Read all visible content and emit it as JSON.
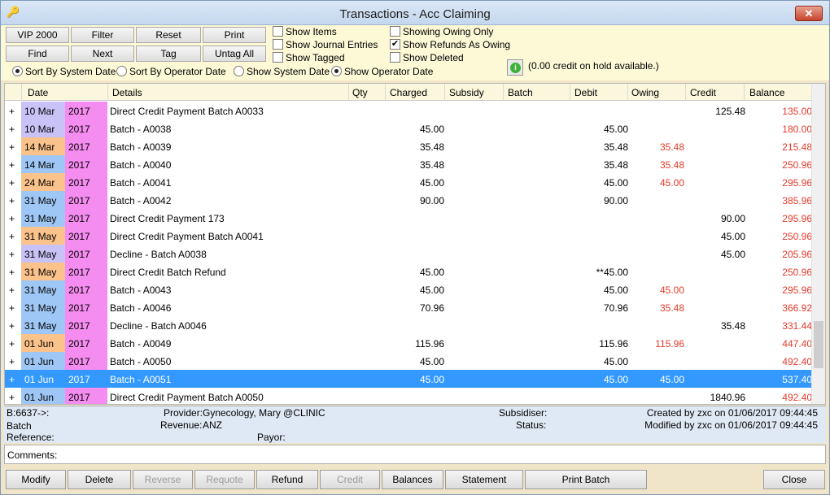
{
  "window": {
    "title": "Transactions - Acc Claiming",
    "close": "✕",
    "icon": "key-icon"
  },
  "toolbar": {
    "row1": [
      "VIP 2000",
      "Filter",
      "Reset",
      "Print"
    ],
    "row2": [
      "Find",
      "Next",
      "Tag",
      "Untag All"
    ],
    "checks": [
      {
        "label": "Show Items",
        "checked": false
      },
      {
        "label": "Show Journal Entries",
        "checked": false
      },
      {
        "label": "Show Tagged",
        "checked": false
      },
      {
        "label": "Showing Owing Only",
        "checked": false
      },
      {
        "label": "Show Refunds As Owing",
        "checked": true
      },
      {
        "label": "Show Deleted",
        "checked": false
      }
    ],
    "radios": [
      {
        "label": "Sort By System Date",
        "on": true
      },
      {
        "label": "Sort By Operator Date",
        "on": false
      },
      {
        "label": "Show System Date",
        "on": false
      },
      {
        "label": "Show Operator Date",
        "on": true
      }
    ],
    "credit_hold": "(0.00 credit on hold available.)",
    "info_icon": "i"
  },
  "grid": {
    "headers": [
      "Date",
      "Details",
      "Qty",
      "Charged",
      "Subsidy",
      "Batch",
      "Debit",
      "Owing",
      "Credit",
      "Balance"
    ],
    "rows": [
      {
        "date": "10 Mar",
        "yr": "2017",
        "details": "Direct Credit Payment   Batch A0033",
        "charged": "",
        "debit": "",
        "owing": "",
        "credit": "125.48",
        "balance": "135.00",
        "dc": "dt-lilac",
        "sel": false
      },
      {
        "date": "10 Mar",
        "yr": "2017",
        "details": "Batch - A0038",
        "charged": "45.00",
        "debit": "45.00",
        "owing": "",
        "credit": "",
        "balance": "180.00",
        "dc": "dt-lilac",
        "sel": false
      },
      {
        "date": "14 Mar",
        "yr": "2017",
        "details": "Batch - A0039",
        "charged": "35.48",
        "debit": "35.48",
        "owing": "35.48",
        "credit": "",
        "balance": "215.48",
        "dc": "dt-orange",
        "sel": false
      },
      {
        "date": "14 Mar",
        "yr": "2017",
        "details": "Batch - A0040",
        "charged": "35.48",
        "debit": "35.48",
        "owing": "35.48",
        "credit": "",
        "balance": "250.96",
        "dc": "dt-blue",
        "sel": false
      },
      {
        "date": "24 Mar",
        "yr": "2017",
        "details": "Batch - A0041",
        "charged": "45.00",
        "debit": "45.00",
        "owing": "45.00",
        "credit": "",
        "balance": "295.96",
        "dc": "dt-orange",
        "sel": false
      },
      {
        "date": "31 May",
        "yr": "2017",
        "details": "Batch - A0042",
        "charged": "90.00",
        "debit": "90.00",
        "owing": "",
        "credit": "",
        "balance": "385.96",
        "dc": "dt-blue",
        "sel": false
      },
      {
        "date": "31 May",
        "yr": "2017",
        "details": "Direct Credit Payment  173",
        "charged": "",
        "debit": "",
        "owing": "",
        "credit": "90.00",
        "balance": "295.96",
        "dc": "dt-blue",
        "sel": false
      },
      {
        "date": "31 May",
        "yr": "2017",
        "details": "Direct Credit Payment   Batch A0041",
        "charged": "",
        "debit": "",
        "owing": "",
        "credit": "45.00",
        "balance": "250.96",
        "dc": "dt-orange",
        "sel": false
      },
      {
        "date": "31 May",
        "yr": "2017",
        "details": "Decline - Batch A0038",
        "charged": "",
        "debit": "",
        "owing": "",
        "credit": "45.00",
        "balance": "205.96",
        "dc": "dt-lilac",
        "sel": false
      },
      {
        "date": "31 May",
        "yr": "2017",
        "details": "Direct Credit Batch Refund",
        "charged": "45.00",
        "debit": "**45.00",
        "owing": "",
        "credit": "",
        "balance": "250.96",
        "dc": "dt-orange",
        "sel": false
      },
      {
        "date": "31 May",
        "yr": "2017",
        "details": "Batch - A0043",
        "charged": "45.00",
        "debit": "45.00",
        "owing": "45.00",
        "credit": "",
        "balance": "295.96",
        "dc": "dt-blue",
        "sel": false
      },
      {
        "date": "31 May",
        "yr": "2017",
        "details": "Batch - A0046",
        "charged": "70.96",
        "debit": "70.96",
        "owing": "35.48",
        "credit": "",
        "balance": "366.92",
        "dc": "dt-blue",
        "sel": false
      },
      {
        "date": "31 May",
        "yr": "2017",
        "details": "Decline - Batch A0046",
        "charged": "",
        "debit": "",
        "owing": "",
        "credit": "35.48",
        "balance": "331.44",
        "dc": "dt-blue",
        "sel": false
      },
      {
        "date": "01 Jun",
        "yr": "2017",
        "details": "Batch - A0049",
        "charged": "115.96",
        "debit": "115.96",
        "owing": "115.96",
        "credit": "",
        "balance": "447.40",
        "dc": "dt-orange",
        "sel": false
      },
      {
        "date": "01 Jun",
        "yr": "2017",
        "details": "Batch - A0050",
        "charged": "45.00",
        "debit": "45.00",
        "owing": "",
        "credit": "",
        "balance": "492.40",
        "dc": "dt-blue",
        "sel": false
      },
      {
        "date": "01 Jun",
        "yr": "2017",
        "details": "Batch - A0051",
        "charged": "45.00",
        "debit": "45.00",
        "owing": "45.00",
        "credit": "",
        "balance": "537.40",
        "dc": "dt-blue",
        "sel": true
      },
      {
        "date": "01 Jun",
        "yr": "2017",
        "details": "Direct Credit Payment   Batch A0050",
        "charged": "",
        "debit": "",
        "owing": "",
        "credit": "1840.96",
        "balance": "492.40",
        "dc": "dt-blue",
        "sel": false
      }
    ]
  },
  "info": {
    "b": "B:6637->:",
    "batch": "Batch",
    "reference": "Reference:",
    "provider_label": "Provider:",
    "provider": "Gynecology, Mary @CLINIC",
    "revenue_label": "Revenue:",
    "revenue": "ANZ",
    "payor": "Payor:",
    "subsidiser": "Subsidiser:",
    "status": "Status:",
    "created": "Created by zxc on 01/06/2017 09:44:45",
    "modified": "Modified by zxc on 01/06/2017 09:44:45"
  },
  "comments_label": "Comments:",
  "bottom": {
    "modify": "Modify",
    "delete": "Delete",
    "reverse": "Reverse",
    "requote": "Requote",
    "refund": "Refund",
    "credit": "Credit",
    "balances": "Balances",
    "statement": "Statement",
    "print_batch": "Print Batch",
    "close": "Close"
  }
}
